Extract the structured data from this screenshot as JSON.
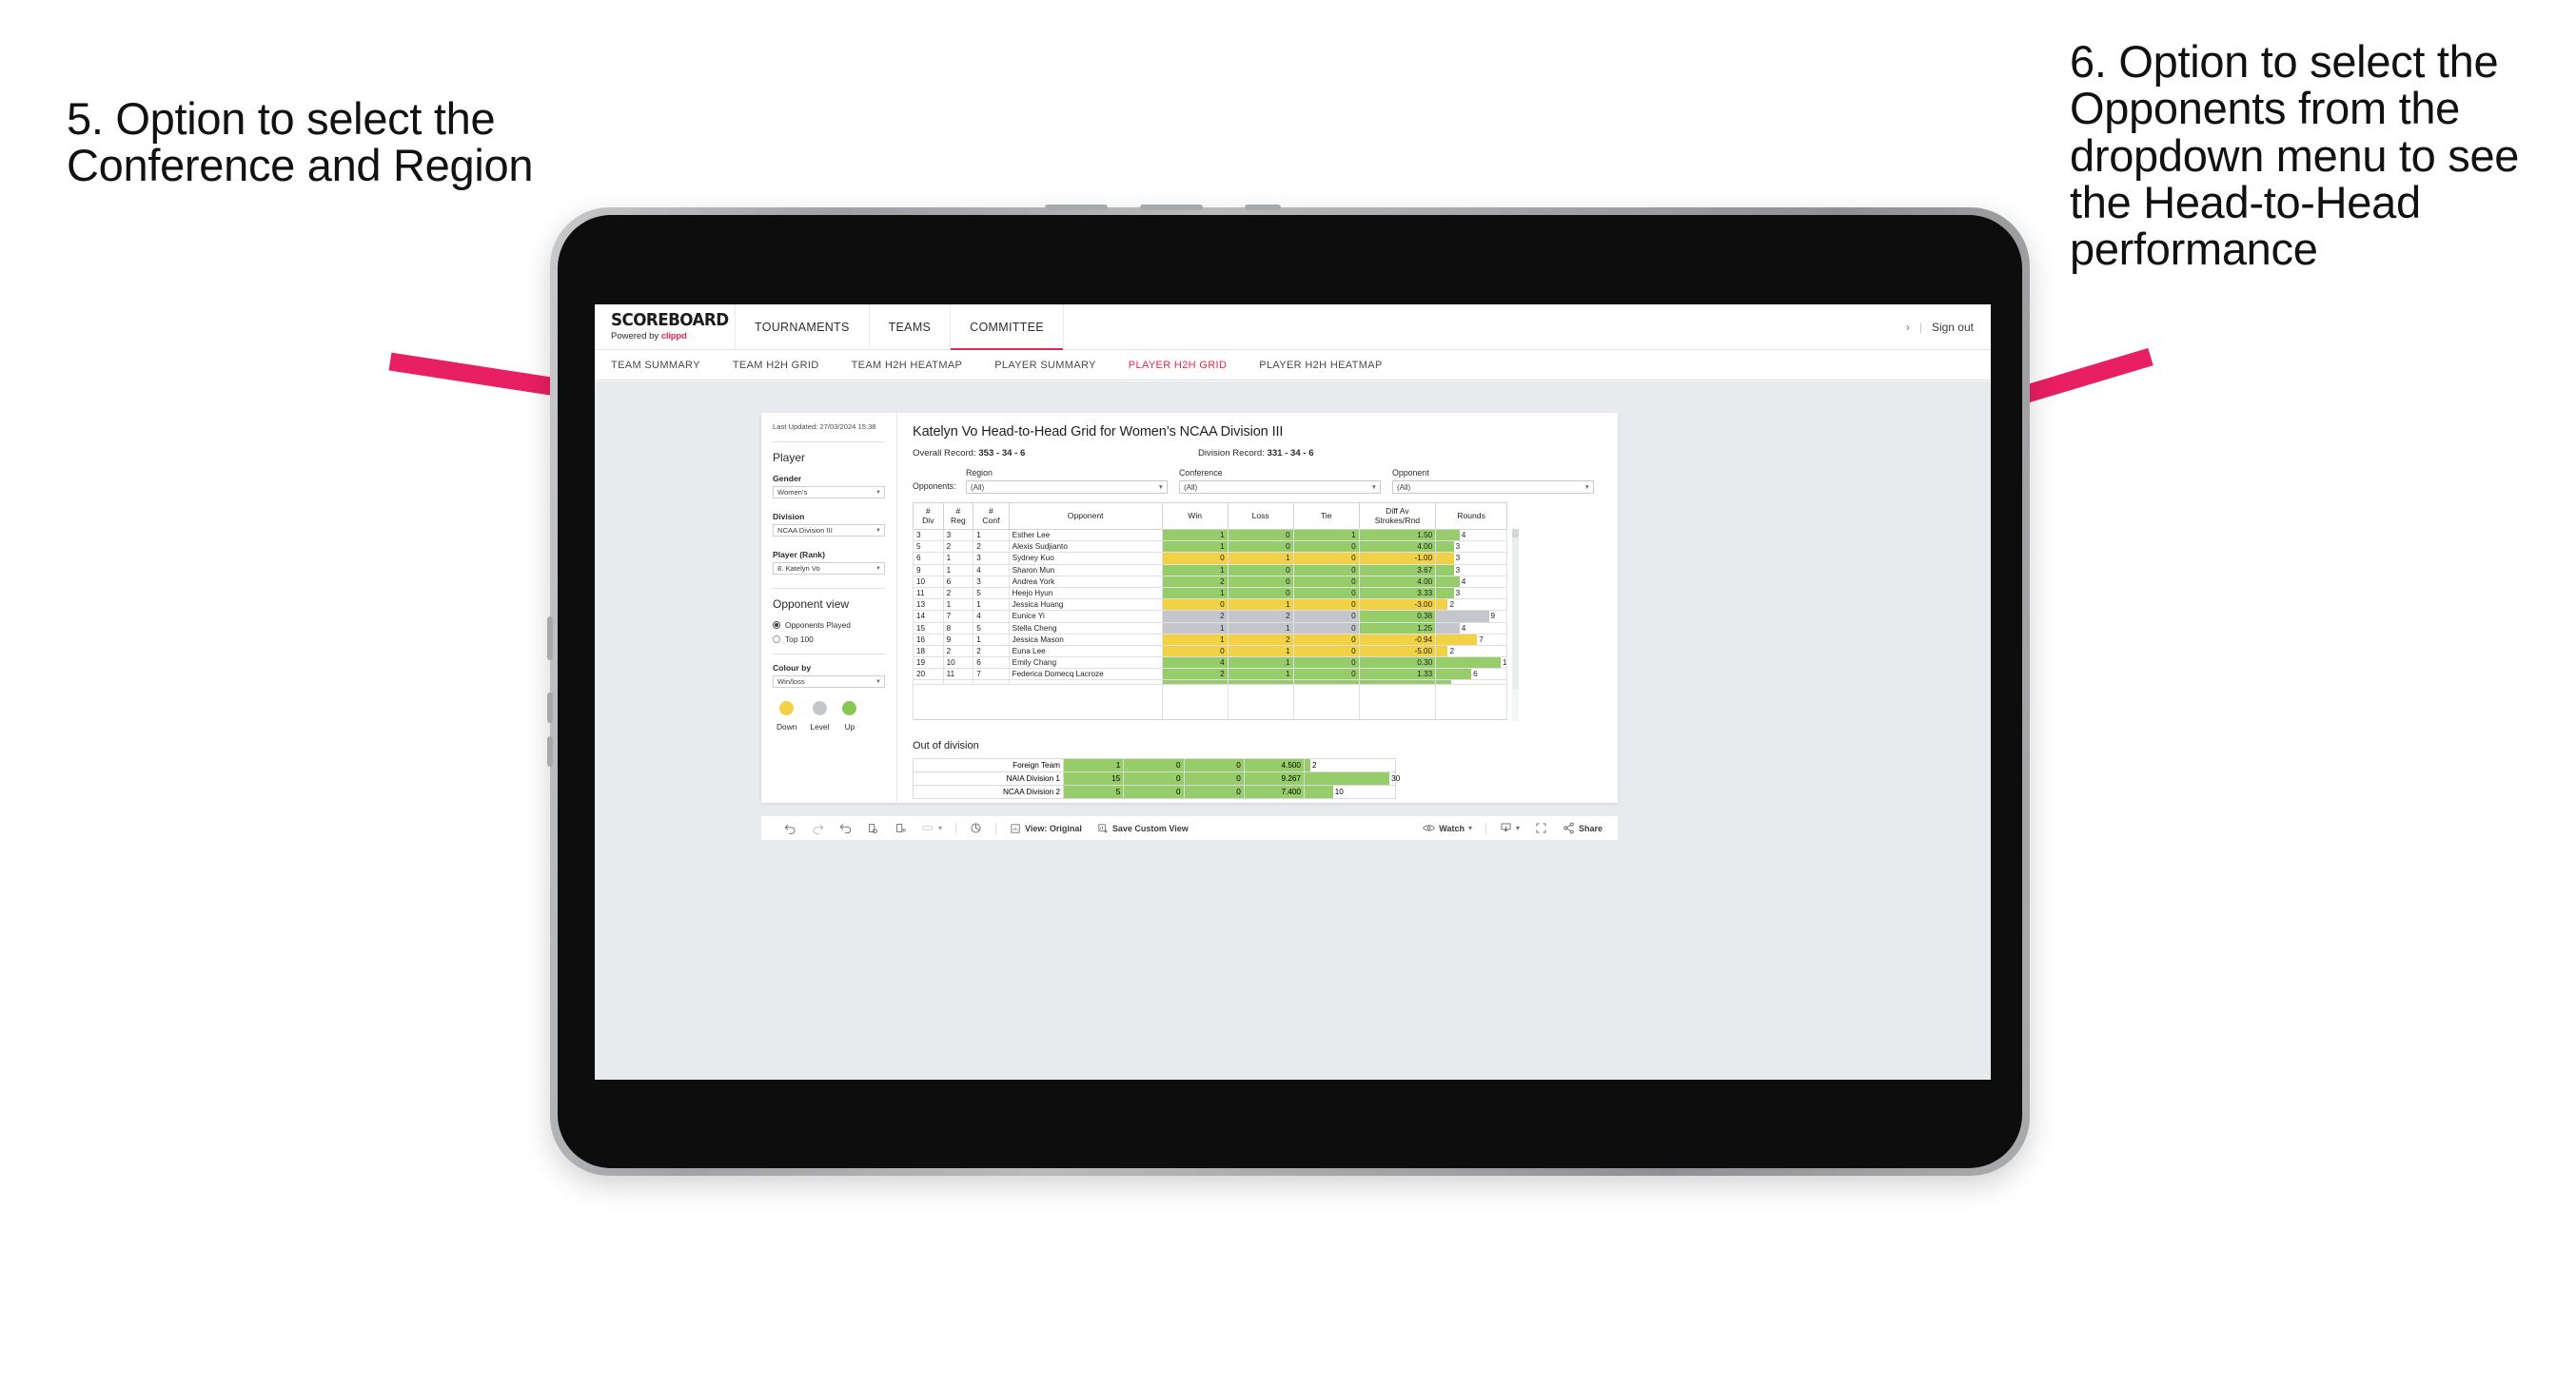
{
  "annotations": {
    "left": "5. Option to select the Conference and Region",
    "right": "6. Option to select the Opponents from the dropdown menu to see the Head-to-Head performance",
    "arrow_color": "#e81f63"
  },
  "app": {
    "brand": {
      "title": "SCOREBOARD",
      "powered_prefix": "Powered by ",
      "powered_name": "clippd"
    },
    "topnav": [
      {
        "label": "TOURNAMENTS",
        "active": false
      },
      {
        "label": "TEAMS",
        "active": false
      },
      {
        "label": "COMMITTEE",
        "active": true
      }
    ],
    "user_chevron": "›",
    "nav_separator": "|",
    "sign_out": "Sign out",
    "subnav": [
      {
        "label": "TEAM SUMMARY",
        "active": false
      },
      {
        "label": "TEAM H2H GRID",
        "active": false
      },
      {
        "label": "TEAM H2H HEATMAP",
        "active": false
      },
      {
        "label": "PLAYER SUMMARY",
        "active": false
      },
      {
        "label": "PLAYER H2H GRID",
        "active": true
      },
      {
        "label": "PLAYER H2H HEATMAP",
        "active": false
      }
    ],
    "accent": "#e8264f"
  },
  "filters": {
    "last_updated": "Last Updated: 27/03/2024 15:38",
    "section_title": "Player",
    "gender": {
      "label": "Gender",
      "value": "Women’s"
    },
    "division": {
      "label": "Division",
      "value": "NCAA Division III"
    },
    "player_rank": {
      "label": "Player (Rank)",
      "value": "8. Katelyn Vo"
    },
    "opponent_view": {
      "title": "Opponent view",
      "options": [
        {
          "label": "Opponents Played",
          "selected": true
        },
        {
          "label": "Top 100",
          "selected": false
        }
      ]
    },
    "colour_by": {
      "label": "Colour by",
      "value": "Win/loss"
    },
    "legend": [
      {
        "label": "Down",
        "color": "#f2d244"
      },
      {
        "label": "Level",
        "color": "#c3c7cb"
      },
      {
        "label": "Up",
        "color": "#86c653"
      }
    ]
  },
  "viz": {
    "title": "Katelyn Vo Head-to-Head Grid for Women’s NCAA Division III",
    "overall_record_label": "Overall Record: ",
    "overall_record_value": "353 -  34 - 6",
    "division_record_label": "Division Record: ",
    "division_record_value": "331 -  34 - 6",
    "opponents_label": "Opponents:",
    "selects": [
      {
        "label": "Region",
        "value": "(All)"
      },
      {
        "label": "Conference",
        "value": "(All)"
      },
      {
        "label": "Opponent",
        "value": "(All)"
      }
    ],
    "columns": [
      "# Div",
      "# Reg",
      "# Conf",
      "Opponent",
      "Win",
      "Loss",
      "Tie",
      "Diff Av Strokes/Rnd",
      "Rounds"
    ],
    "col_div_top": "#",
    "col_div_bot": "Div",
    "col_reg_top": "#",
    "col_reg_bot": "Reg",
    "col_conf_top": "#",
    "col_conf_bot": "Conf",
    "col_opponent": "Opponent",
    "col_win": "Win",
    "col_loss": "Loss",
    "col_tie": "Tie",
    "col_diff_top": "Diff Av",
    "col_diff_bot": "Strokes/Rnd",
    "col_rounds": "Rounds",
    "out_of_division_title": "Out of division"
  },
  "chart_data": {
    "type": "table",
    "title": "Katelyn Vo Head-to-Head Grid for Women’s NCAA Division III",
    "columns": [
      "# Div",
      "# Reg",
      "# Conf",
      "Opponent",
      "Win",
      "Loss",
      "Tie",
      "Diff Av Strokes/Rnd",
      "Rounds"
    ],
    "colour_scale": {
      "down": "#f2d244",
      "level": "#c3c7cb",
      "up": "#97cc6b"
    },
    "rounds_max": 12,
    "rows": [
      {
        "div": "3",
        "reg": "3",
        "conf": "1",
        "opponent": "Esther Lee",
        "win": "1",
        "loss": "0",
        "tie": "1",
        "diff": "1.50",
        "rounds": "4",
        "rounds_n": 4,
        "state": "up"
      },
      {
        "div": "5",
        "reg": "2",
        "conf": "2",
        "opponent": "Alexis Sudjianto",
        "win": "1",
        "loss": "0",
        "tie": "0",
        "diff": "4.00",
        "rounds": "3",
        "rounds_n": 3,
        "state": "up"
      },
      {
        "div": "6",
        "reg": "1",
        "conf": "3",
        "opponent": "Sydney Kuo",
        "win": "0",
        "loss": "1",
        "tie": "0",
        "diff": "-1.00",
        "rounds": "3",
        "rounds_n": 3,
        "state": "down"
      },
      {
        "div": "9",
        "reg": "1",
        "conf": "4",
        "opponent": "Sharon Mun",
        "win": "1",
        "loss": "0",
        "tie": "0",
        "diff": "3.67",
        "rounds": "3",
        "rounds_n": 3,
        "state": "up"
      },
      {
        "div": "10",
        "reg": "6",
        "conf": "3",
        "opponent": "Andrea York",
        "win": "2",
        "loss": "0",
        "tie": "0",
        "diff": "4.00",
        "rounds": "4",
        "rounds_n": 4,
        "state": "up"
      },
      {
        "div": "11",
        "reg": "2",
        "conf": "5",
        "opponent": "Heejo Hyun",
        "win": "1",
        "loss": "0",
        "tie": "0",
        "diff": "3.33",
        "rounds": "3",
        "rounds_n": 3,
        "state": "up"
      },
      {
        "div": "13",
        "reg": "1",
        "conf": "1",
        "opponent": "Jessica Huang",
        "win": "0",
        "loss": "1",
        "tie": "0",
        "diff": "-3.00",
        "rounds": "2",
        "rounds_n": 2,
        "state": "down"
      },
      {
        "div": "14",
        "reg": "7",
        "conf": "4",
        "opponent": "Eunice Yi",
        "win": "2",
        "loss": "2",
        "tie": "0",
        "diff": "0.38",
        "rounds": "9",
        "rounds_n": 9,
        "state": "level",
        "diff_state": "up"
      },
      {
        "div": "15",
        "reg": "8",
        "conf": "5",
        "opponent": "Stella Cheng",
        "win": "1",
        "loss": "1",
        "tie": "0",
        "diff": "1.25",
        "rounds": "4",
        "rounds_n": 4,
        "state": "level",
        "diff_state": "up"
      },
      {
        "div": "16",
        "reg": "9",
        "conf": "1",
        "opponent": "Jessica Mason",
        "win": "1",
        "loss": "2",
        "tie": "0",
        "diff": "-0.94",
        "rounds": "7",
        "rounds_n": 7,
        "state": "down"
      },
      {
        "div": "18",
        "reg": "2",
        "conf": "2",
        "opponent": "Euna Lee",
        "win": "0",
        "loss": "1",
        "tie": "0",
        "diff": "-5.00",
        "rounds": "2",
        "rounds_n": 2,
        "state": "down"
      },
      {
        "div": "19",
        "reg": "10",
        "conf": "6",
        "opponent": "Emily Chang",
        "win": "4",
        "loss": "1",
        "tie": "0",
        "diff": "0.30",
        "rounds": "11",
        "rounds_n": 11,
        "state": "up"
      },
      {
        "div": "20",
        "reg": "11",
        "conf": "7",
        "opponent": "Federica Domecq Lacroze",
        "win": "2",
        "loss": "1",
        "tie": "0",
        "diff": "1.33",
        "rounds": "6",
        "rounds_n": 6,
        "state": "up"
      }
    ],
    "out_of_division": {
      "title": "Out of division",
      "rounds_max": 32,
      "rows": [
        {
          "name": "Foreign Team",
          "win": "1",
          "loss": "0",
          "tie": "0",
          "diff": "4.500",
          "rounds": "2",
          "rounds_n": 2,
          "state": "up"
        },
        {
          "name": "NAIA Division 1",
          "win": "15",
          "loss": "0",
          "tie": "0",
          "diff": "9.267",
          "rounds": "30",
          "rounds_n": 30,
          "state": "up"
        },
        {
          "name": "NCAA Division 2",
          "win": "5",
          "loss": "0",
          "tie": "0",
          "diff": "7.400",
          "rounds": "10",
          "rounds_n": 10,
          "state": "up"
        }
      ]
    }
  },
  "toolbar": {
    "undo": "undo-icon",
    "redo": "redo-icon",
    "revert": "revert-icon",
    "refresh": "refresh-data-icon",
    "pause": "pause-auto-update-icon",
    "highlight": "highlight-icon",
    "highlight_caret": "▾",
    "slideshow": "slideshow-icon",
    "view_label": "View: Original",
    "save_custom_view": "Save Custom View",
    "watch": "Watch",
    "watch_caret": "▾",
    "download_caret": "▾",
    "fullscreen": "fullscreen-icon",
    "share": "Share"
  }
}
